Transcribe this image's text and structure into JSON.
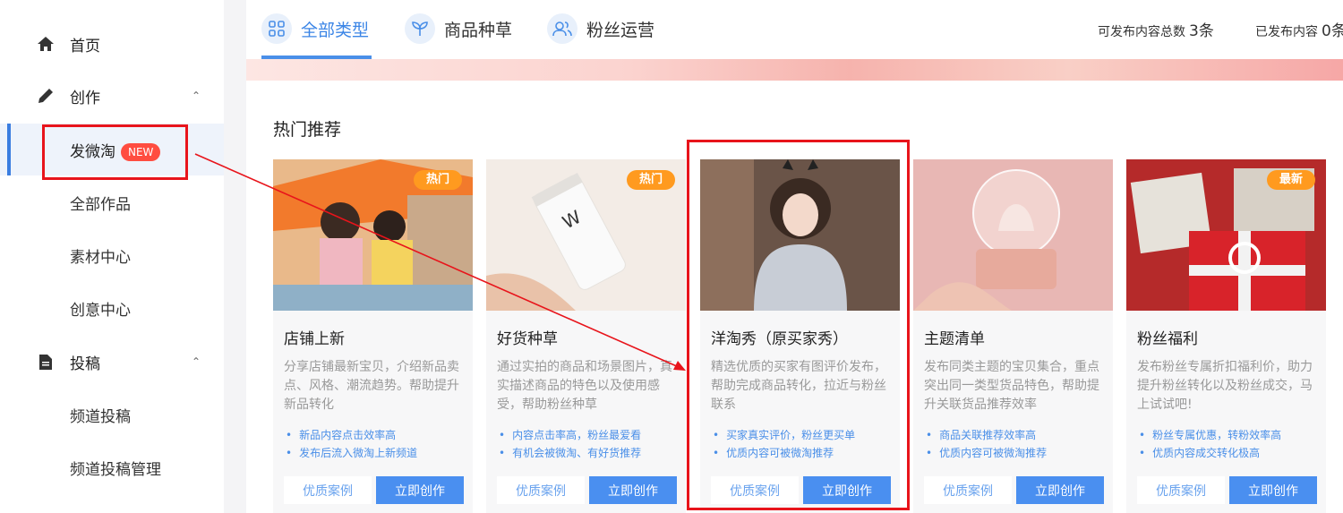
{
  "sidebar": {
    "items": [
      {
        "label": "首页",
        "icon": "home-icon"
      },
      {
        "label": "创作",
        "icon": "pencil-icon",
        "caret": "⌃"
      },
      {
        "label": "发微淘",
        "badge": "NEW"
      },
      {
        "label": "全部作品"
      },
      {
        "label": "素材中心"
      },
      {
        "label": "创意中心"
      },
      {
        "label": "投稿",
        "icon": "document-icon",
        "caret": "⌃"
      },
      {
        "label": "频道投稿"
      },
      {
        "label": "频道投稿管理"
      }
    ]
  },
  "tabs": [
    {
      "label": "全部类型",
      "icon": "grid-icon"
    },
    {
      "label": "商品种草",
      "icon": "sprout-icon"
    },
    {
      "label": "粉丝运营",
      "icon": "users-icon"
    }
  ],
  "stats": {
    "total_label": "可发布内容总数",
    "total_value": "3条",
    "published_label": "已发布内容",
    "published_value": "0条"
  },
  "section_title": "热门推荐",
  "cards": [
    {
      "tag": "热门",
      "title": "店铺上新",
      "desc": "分享店铺最新宝贝，介绍新品卖点、风格、潮流趋势。帮助提升新品转化",
      "bullets": [
        "新品内容点击效率高",
        "发布后流入微淘上新频道"
      ],
      "btn_case": "优质案例",
      "btn_create": "立即创作"
    },
    {
      "tag": "热门",
      "title": "好货种草",
      "desc": "通过实拍的商品和场景图片，真实描述商品的特色以及使用感受，帮助粉丝种草",
      "bullets": [
        "内容点击率高，粉丝最爱看",
        "有机会被微淘、有好货推荐"
      ],
      "btn_case": "优质案例",
      "btn_create": "立即创作"
    },
    {
      "tag": "",
      "title": "洋淘秀（原买家秀）",
      "desc": "精选优质的买家有图评价发布，帮助完成商品转化，拉近与粉丝联系",
      "bullets": [
        "买家真实评价，粉丝更买单",
        "优质内容可被微淘推荐"
      ],
      "btn_case": "优质案例",
      "btn_create": "立即创作"
    },
    {
      "tag": "",
      "title": "主题清单",
      "desc": "发布同类主题的宝贝集合，重点突出同一类型货品特色，帮助提升关联货品推荐效率",
      "bullets": [
        "商品关联推荐效率高",
        "优质内容可被微淘推荐"
      ],
      "btn_case": "优质案例",
      "btn_create": "立即创作"
    },
    {
      "tag": "最新",
      "title": "粉丝福利",
      "desc": "发布粉丝专属折扣福利价，助力提升粉丝转化以及粉丝成交，马上试试吧!",
      "bullets": [
        "粉丝专属优惠，转粉效率高",
        "优质内容成交转化极高"
      ],
      "btn_case": "优质案例",
      "btn_create": "立即创作"
    }
  ],
  "colors": {
    "accent": "#4a8ff0",
    "highlight": "#e8141b",
    "tag": "#ff9a1f",
    "badge": "#ff4d40"
  }
}
